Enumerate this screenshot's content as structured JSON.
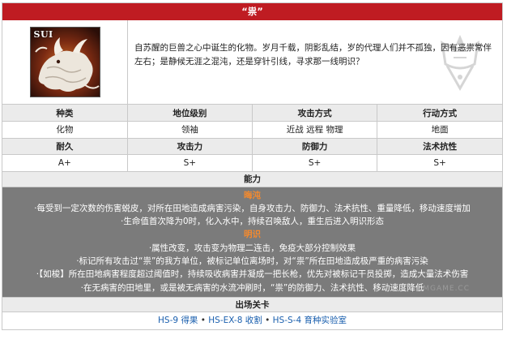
{
  "title": "“祟”",
  "portrait": {
    "tag": "SUI",
    "icon": "white-beast-portrait"
  },
  "description": "自苏醒的巨兽之心中诞生的化物。岁月千载，阴影乱结，岁的代理人们并不孤独，因有恶祟常伴左右；是静候无涯之混沌，还是穿针引线，寻求那一线明识？",
  "watermark_icon": "rhodes-crest-icon",
  "stats": {
    "row1_headers": [
      "种类",
      "地位级别",
      "攻击方式",
      "行动方式"
    ],
    "row1_values": [
      "化物",
      "领袖",
      "近战 远程 物理",
      "地面"
    ],
    "row2_headers": [
      "耐久",
      "攻击力",
      "防御力",
      "法术抗性"
    ],
    "row2_values": [
      "A+",
      "S+",
      "S+",
      "S+"
    ]
  },
  "abilities": {
    "header": "能力",
    "phase1_title": "晦沌",
    "phase1_lines": [
      "·每受到一定次数的伤害蜕皮，对所在田地造成病害污染，自身攻击力、防御力、法术抗性、重量降低，移动速度增加",
      "·生命值首次降为0时，化入水中，持续召唤敌人，重生后进入明识形态"
    ],
    "phase2_title": "明识",
    "phase2_lines": [
      "·属性改变，攻击变为物理二连击，免疫大部分控制效果",
      "·标记所有攻击过“祟”的我方单位，被标记单位离场时，对“祟”所在田地造成极严重的病害污染",
      "·【如梭】所在田地病害程度超过阈值时，持续吸收病害并凝成一把长枪，优先对被标记干员投掷，造成大量法术伤害",
      "·在无病害的田地里，或是被无病害的水流冲刷时，“祟”的防御力、法术抗性、移动速度降低"
    ],
    "watermark": "MGAME.CC"
  },
  "stages": {
    "header": "出场关卡",
    "links": [
      "HS-9 得果",
      "HS-EX-8 收割",
      "HS-S-4 育种实验室"
    ],
    "separator": "•"
  }
}
